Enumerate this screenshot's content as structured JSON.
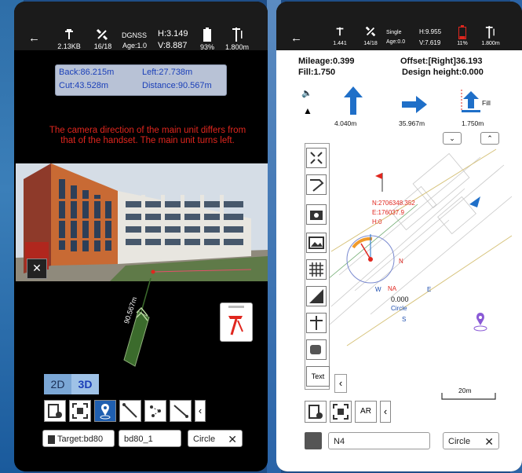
{
  "left_phone": {
    "status": {
      "back_icon": "back-arrow-icon",
      "data_rate": "2.13KB",
      "satellites": "16/18",
      "solution": "DGNSS",
      "age": "Age:1.0",
      "h_precision": "H:3.149",
      "v_precision": "V:8.887",
      "battery": "93%",
      "pole_height": "1.800m"
    },
    "info": {
      "back": "Back:86.215m",
      "left": "Left:27.738m",
      "cut": "Cut:43.528m",
      "distance": "Distance:90.567m"
    },
    "warning": "The camera direction of the main unit differs from that of the handset. The main unit turns left.",
    "arrow_distance": "90.567m",
    "view_toggle": {
      "option_2d": "2D",
      "option_3d": "3D",
      "selected": "3D"
    },
    "target_label": "Target:bd80",
    "point_name": "bd80_1",
    "mode": "Circle",
    "clear_icon": "close-icon"
  },
  "right_phone": {
    "status": {
      "data_rate": "1.441",
      "satellites": "14/18",
      "solution": "Single",
      "age": "Age:0.0",
      "h_precision": "H:9.955",
      "v_precision": "V:7.619",
      "battery": "11%",
      "pole_height": "1.800m"
    },
    "header": {
      "mileage": "Mileage:0.399",
      "offset": "Offset:[Right]36.193",
      "fill": "Fill:1.750",
      "design_height": "Design height:0.000"
    },
    "directions": {
      "forward": "4.040m",
      "right": "35.967m",
      "fill": "1.750m",
      "fill_label": "Fill"
    },
    "map": {
      "coord_n": "N:2706348.352",
      "coord_e": "E:176037.9",
      "coord_h": "H:0",
      "compass_center": "0.000",
      "compass_label": "Circle",
      "n": "N",
      "e": "E",
      "s": "S",
      "w": "W",
      "na": "NA",
      "scale": "20m"
    },
    "text_button": "Text",
    "ar_button": "AR",
    "point_name": "N4",
    "mode": "Circle"
  },
  "colors": {
    "accent": "#1f5fb0",
    "warning": "#e0261e",
    "info_text": "#1a3fb8",
    "arrow_green": "#3b6b2c"
  }
}
